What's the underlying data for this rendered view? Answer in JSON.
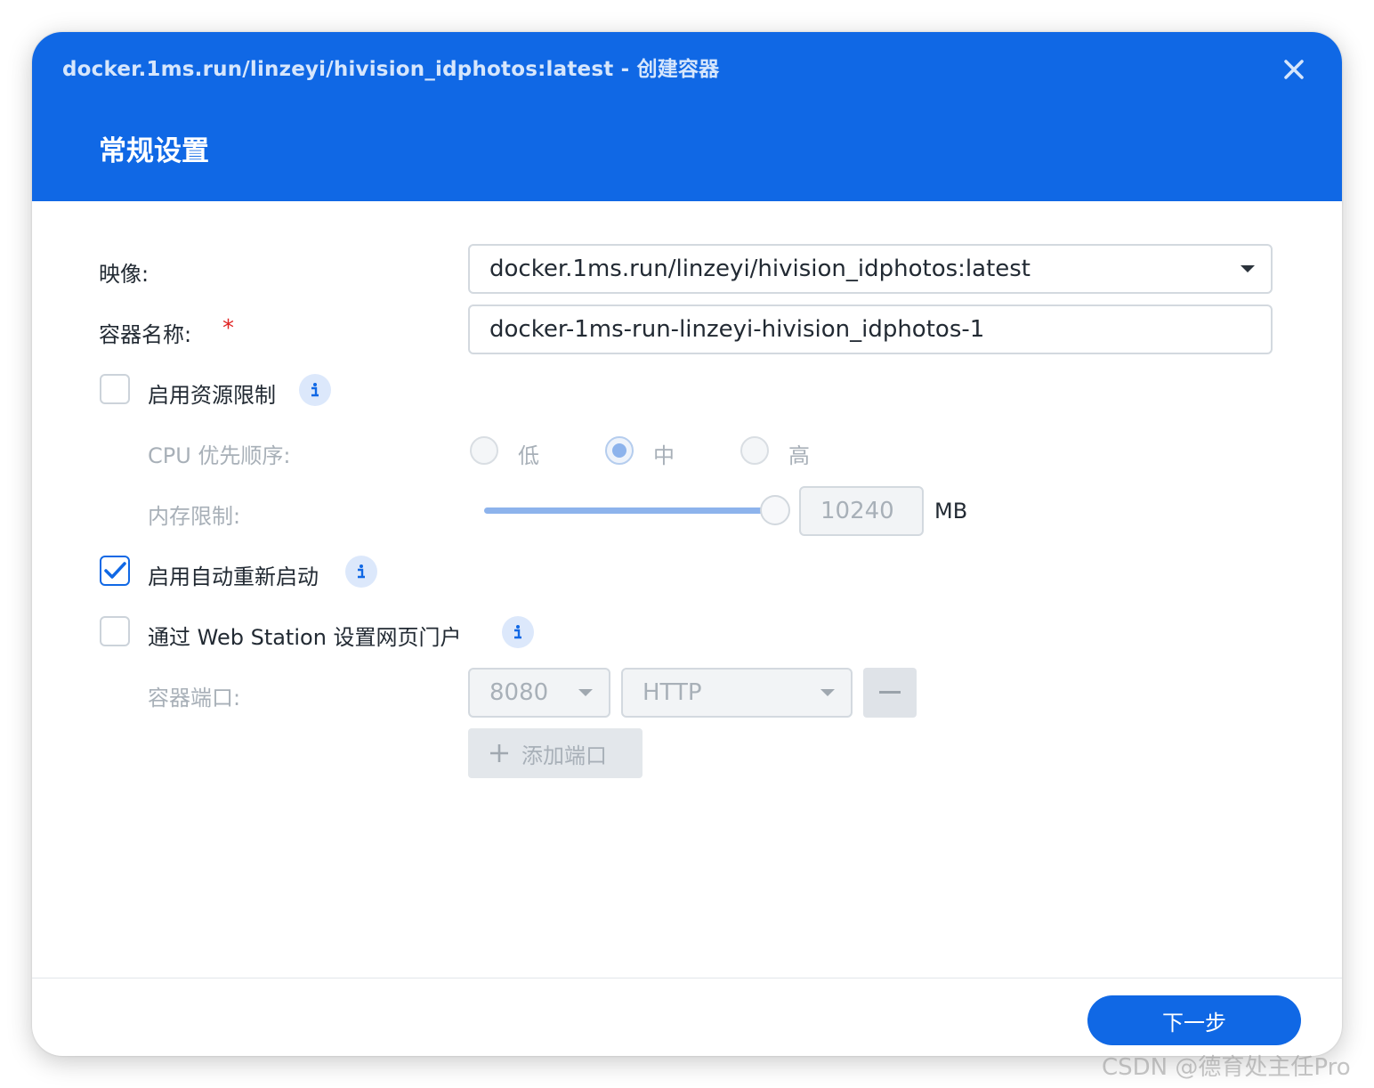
{
  "dialog": {
    "title": "docker.1ms.run/linzeyi/hivision_idphotos:latest - 创建容器",
    "step_title": "常规设置",
    "close_icon": "close-icon"
  },
  "form": {
    "image_label": "映像:",
    "image_value": "docker.1ms.run/linzeyi/hivision_idphotos:latest",
    "name_label": "容器名称:",
    "required_mark": "*",
    "name_value": "docker-1ms-run-linzeyi-hivision_idphotos-1",
    "resource_limit": {
      "label": "启用资源限制",
      "checked": false
    },
    "cpu_label": "CPU 优先顺序:",
    "cpu_options": [
      "低",
      "中",
      "高"
    ],
    "cpu_selected": "中",
    "memory_label": "内存限制:",
    "memory_value": "10240",
    "memory_unit": "MB",
    "memory_slider_fraction": 1.0,
    "auto_restart": {
      "label": "启用自动重新启动",
      "checked": true
    },
    "web_station": {
      "label": "通过 Web Station 设置网页门户",
      "checked": false
    },
    "port_label": "容器端口:",
    "port_value": "8080",
    "protocol_value": "HTTP",
    "add_port_label": "添加端口"
  },
  "footer": {
    "next_label": "下一步"
  },
  "watermark": "CSDN @德育处主任Pro",
  "colors": {
    "accent": "#1068e5",
    "required": "#e02424"
  }
}
